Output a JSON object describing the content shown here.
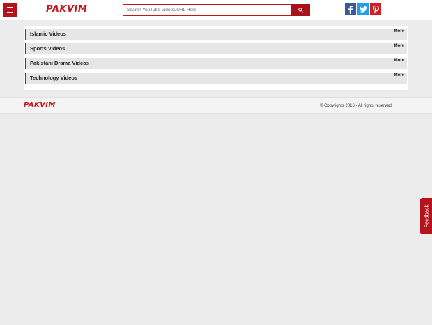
{
  "header": {
    "logo_text": "PAKVIM",
    "search": {
      "placeholder": "Search YouTube Videos/URL Here",
      "value": ""
    },
    "social": {
      "facebook": "f",
      "twitter": "t",
      "pinterest": "p"
    }
  },
  "categories": [
    {
      "title": "Islamic Videos",
      "more": "More"
    },
    {
      "title": "Sports Videos",
      "more": "More"
    },
    {
      "title": "Pakistani Drama Videos",
      "more": "More"
    },
    {
      "title": "Technology Videos",
      "more": "More"
    }
  ],
  "footer": {
    "logo_text": "PAKVIM",
    "copyright": "© Copyrights 2016 - All rights reserved"
  },
  "feedback_label": "Feedback",
  "colors": {
    "brand": "#b5121b",
    "facebook": "#3b5998",
    "twitter": "#1da1f2",
    "pinterest": "#cb2027"
  }
}
